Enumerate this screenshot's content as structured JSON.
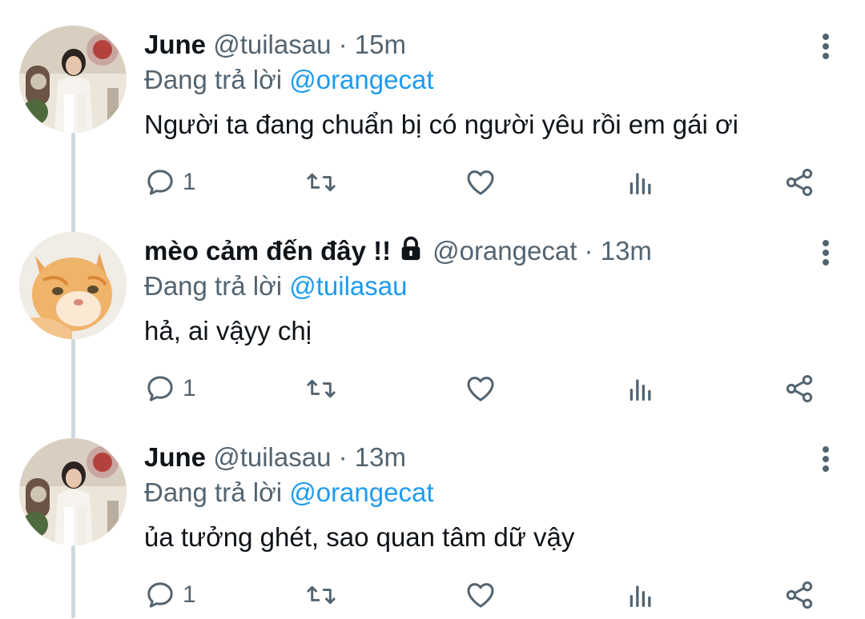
{
  "tweets": [
    {
      "display_name": "June",
      "handle": "@tuilasau",
      "separator": "·",
      "time": "15m",
      "reply_prefix": "Đang trả lời",
      "reply_to": "@orangecat",
      "text": "Người ta đang chuẩn bị có người yêu rồi em gái ơi",
      "reply_count": "1",
      "avatar": "woman-photo"
    },
    {
      "display_name": "mèo cảm đến đây !!",
      "handle": "@orangecat",
      "separator": "·",
      "time": "13m",
      "reply_prefix": "Đang trả lời",
      "reply_to": "@tuilasau",
      "text": "hả, ai vậyy chị",
      "reply_count": "1",
      "avatar": "orange-cat-photo",
      "protected_icon": "lock-icon"
    },
    {
      "display_name": "June",
      "handle": "@tuilasau",
      "separator": "·",
      "time": "13m",
      "reply_prefix": "Đang trả lời",
      "reply_to": "@orangecat",
      "text": "ủa tưởng ghét, sao quan tâm dữ vậy",
      "reply_count": "1",
      "avatar": "woman-photo"
    }
  ],
  "icons": {
    "reply": "reply-icon",
    "retweet": "retweet-icon",
    "like": "heart-icon",
    "views": "views-icon",
    "share": "share-icon",
    "more": "more-vertical-icon"
  },
  "colors": {
    "text": "#0f1419",
    "secondary": "#536471",
    "link": "#1d9bf0",
    "thread_line": "#cfd9de"
  }
}
